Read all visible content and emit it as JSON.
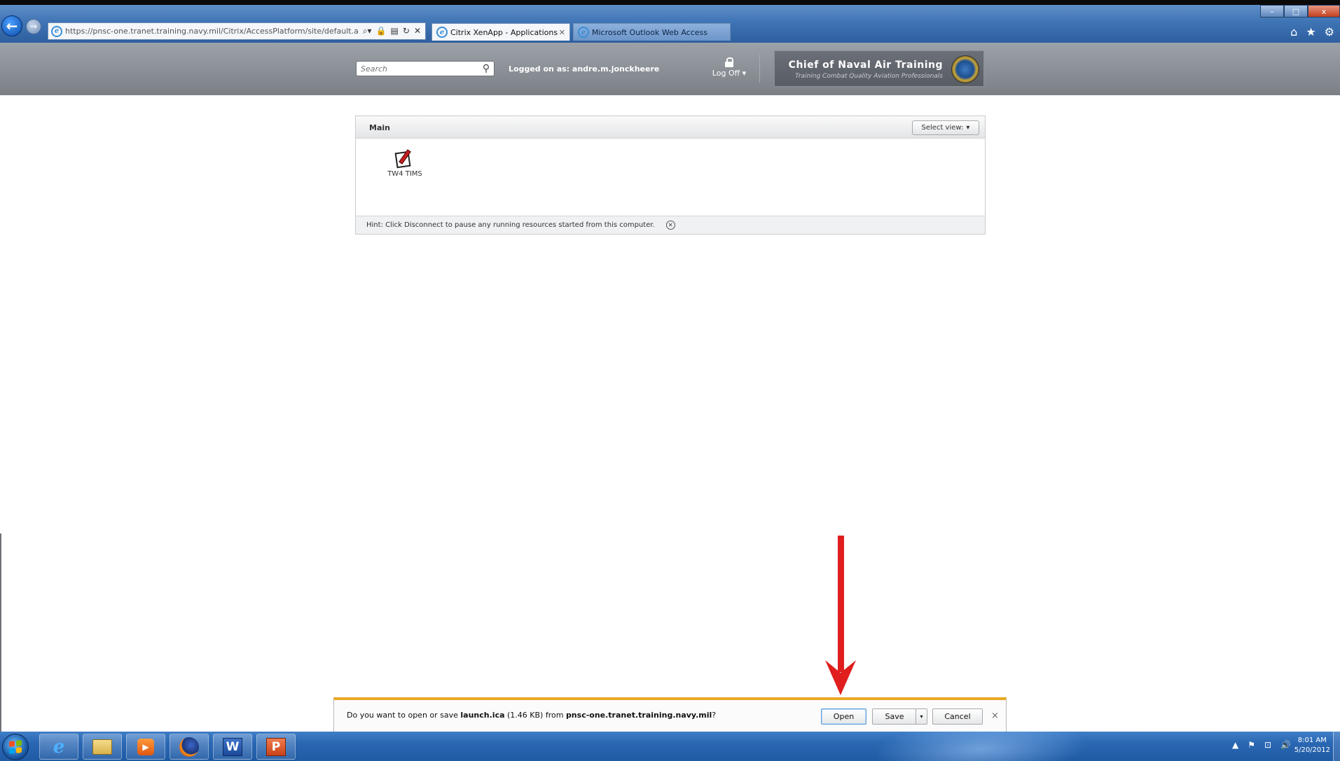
{
  "browser": {
    "url": "https://pnsc-one.tranet.training.navy.mil/Citrix/AccessPlatform/site/default.as",
    "tabs": [
      {
        "label": "Citrix XenApp - Applications",
        "active": true
      },
      {
        "label": "Microsoft Outlook Web Access",
        "active": false
      }
    ],
    "window_controls": {
      "minimize": "–",
      "maximize": "□",
      "close": "x"
    }
  },
  "header": {
    "search_placeholder": "Search",
    "logged_on_text": "Logged on as: andre.m.jonckheere",
    "logoff_label": "Log Off ▾",
    "brand_title": "Chief of Naval Air Training",
    "brand_subtitle": "Training Combat Quality Aviation Professionals"
  },
  "main_panel": {
    "title": "Main",
    "select_view_label": "Select view:",
    "apps": [
      {
        "label": "TW4 TIMS",
        "icon": "pen-and-paper-icon"
      }
    ],
    "hint": "Hint: Click Disconnect to pause any running resources started from this computer."
  },
  "download_bar": {
    "text_prefix": "Do you want to open or save ",
    "file_name": "launch.ica",
    "file_size": " (1.46 KB) from ",
    "source": "pnsc-one.tranet.training.navy.mil",
    "text_suffix": "?",
    "open_label": "Open",
    "save_label": "Save",
    "save_dropdown": "▾",
    "cancel_label": "Cancel",
    "close_label": "×"
  },
  "taskbar": {
    "clock_time": "8:01 AM",
    "clock_date": "5/20/2012",
    "word_label": "W",
    "ppt_label": "P"
  },
  "colors": {
    "arrow": "#e01e1e",
    "notification_accent": "#e8a825",
    "header_gray": "#8a8f95"
  }
}
